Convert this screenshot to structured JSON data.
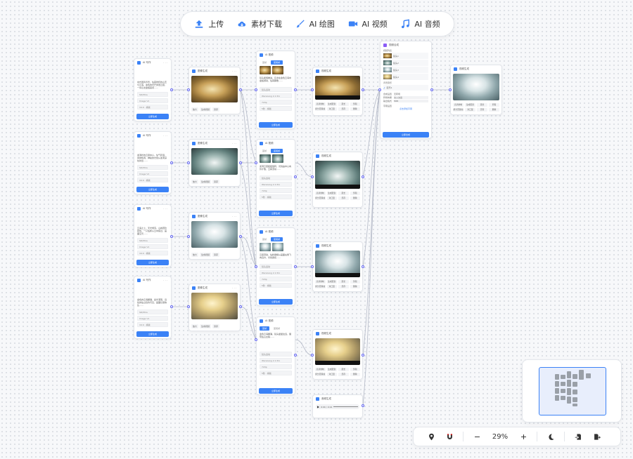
{
  "toolbar": {
    "items": [
      {
        "label": "上传",
        "icon": "upload-icon"
      },
      {
        "label": "素材下载",
        "icon": "cloud-download-icon"
      },
      {
        "label": "AI 绘图",
        "icon": "brush-icon"
      },
      {
        "label": "AI 视频",
        "icon": "video-camera-icon"
      },
      {
        "label": "AI 音频",
        "icon": "music-note-icon"
      }
    ],
    "accent": "#3b82f6"
  },
  "canvas": {
    "prompt_nodes": [
      {
        "title": "AI 写作",
        "text": "中式国风背景，仙雾缭绕的山峦与云海，金色的光芒穿透云层，一条巨龙盘旋其间……",
        "fields": [
          "SD/Mira",
          "Image V1",
          "16:9 · 横版"
        ],
        "button": "立即生成"
      },
      {
        "title": "AI 写作",
        "text": "漩涡状的云层中心，仙气弥漫，青绿色调，神秘的光线从漩涡深处射出……",
        "fields": [
          "SD/Mira",
          "Image V1",
          "16:9 · 横版"
        ],
        "button": "立即生成"
      },
      {
        "title": "AI 写作",
        "text": "云海之上，天光倾泻，山峰若隐若现，一只仙鹤从云中掠过，画面空灵……",
        "fields": [
          "SD/Mira",
          "Image V1",
          "16:9 · 横版"
        ],
        "button": "立即生成"
      },
      {
        "title": "AI 写作",
        "text": "金色的云海翻涌，晨光洒落，远处的仙山隐约可见，画面壮丽恢弘……",
        "fields": [
          "SD/Mira",
          "Image V1",
          "16:9 · 横版"
        ],
        "button": "立即生成"
      }
    ],
    "image_nodes": [
      {
        "title": "图像生成",
        "buttons": [
          "放大",
          "生成视频",
          "另存"
        ]
      },
      {
        "title": "图像生成",
        "buttons": [
          "放大",
          "生成视频",
          "另存"
        ]
      },
      {
        "title": "图像生成",
        "buttons": [
          "放大",
          "生成视频",
          "另存"
        ]
      },
      {
        "title": "图像生成",
        "buttons": [
          "放大",
          "生成视频",
          "另存"
        ]
      }
    ],
    "video_gen_nodes": [
      {
        "title": "AI 视频",
        "tabs": [
          "首帧",
          "首尾帧"
        ],
        "text": "镜头缓慢推进，巨龙在金色云海中盘旋游动，仙雾飘散……",
        "fields": [
          "镜头运动",
          "Wanxiang 2.1 Pro",
          "720p",
          "5秒 · 横版"
        ],
        "button": "立即生成"
      },
      {
        "title": "AI 视频",
        "tabs": [
          "首帧",
          "首尾帧"
        ],
        "text": "漩涡云层缓缓旋转，光线由中心向外扩散，云雾流动……",
        "fields": [
          "镜头运动",
          "Wanxiang 2.1 Pro",
          "720p",
          "5秒 · 横版"
        ],
        "button": "立即生成"
      },
      {
        "title": "AI 视频",
        "tabs": [
          "首帧",
          "首尾帧"
        ],
        "text": "云层流动，仙鹤振翅从画面右侧飞向远方，光线柔和……",
        "fields": [
          "镜头运动",
          "Wanxiang 2.1 Pro",
          "720p",
          "5秒 · 横版"
        ],
        "button": "立即生成"
      },
      {
        "title": "AI 视频",
        "tabs": [
          "首帧",
          "首尾帧"
        ],
        "text": "金色云海翻涌，镜头缓缓拉远，展现仙山全貌……",
        "fields": [
          "镜头运动",
          "Wanxiang 2.1 Pro",
          "720p",
          "5秒 · 横版"
        ],
        "button": "立即生成"
      }
    ],
    "video_nodes": [
      {
        "title": "视频生成",
        "buttons": [
          "高清重制",
          "生成配音",
          "延长",
          "剪辑",
          "拆分首尾帧",
          "对口型",
          "另存",
          "删除"
        ]
      },
      {
        "title": "视频生成",
        "buttons": [
          "高清重制",
          "生成配音",
          "延长",
          "剪辑",
          "拆分首尾帧",
          "对口型",
          "另存",
          "删除"
        ]
      },
      {
        "title": "视频生成",
        "buttons": [
          "高清重制",
          "生成配音",
          "延长",
          "剪辑",
          "拆分首尾帧",
          "对口型",
          "另存",
          "删除"
        ]
      },
      {
        "title": "视频生成",
        "buttons": [
          "高清重制",
          "生成配音",
          "延长",
          "剪辑",
          "拆分首尾帧",
          "对口型",
          "另存",
          "删除"
        ]
      }
    ],
    "audio_node": {
      "title": "音频生成",
      "time": "0:00 / 0:12"
    },
    "merge_node": {
      "title": "视频合成",
      "section1": "视频列表",
      "clips": [
        "镜头1",
        "镜头2",
        "镜头3",
        "镜头4"
      ],
      "section2": "背景音乐",
      "audio_clip": "配乐1",
      "labels": [
        "合成设置",
        "转场效果",
        "输出格式"
      ],
      "values": [
        "无转场",
        "淡入淡出",
        "MP4"
      ],
      "section3": "字幕设置",
      "hint": "点击添加字幕",
      "button": "立即合成"
    },
    "result_node": {
      "title": "视频生成",
      "buttons": [
        "高清重制",
        "生成配音",
        "延长",
        "剪辑",
        "拆分首尾帧",
        "对口型",
        "另存",
        "删除"
      ]
    }
  },
  "controls": {
    "zoom": "29%",
    "icons": [
      "locate-icon",
      "magnet-icon",
      "zoom-out-icon",
      "zoom-in-icon",
      "moon-icon",
      "import-icon",
      "export-icon"
    ]
  }
}
